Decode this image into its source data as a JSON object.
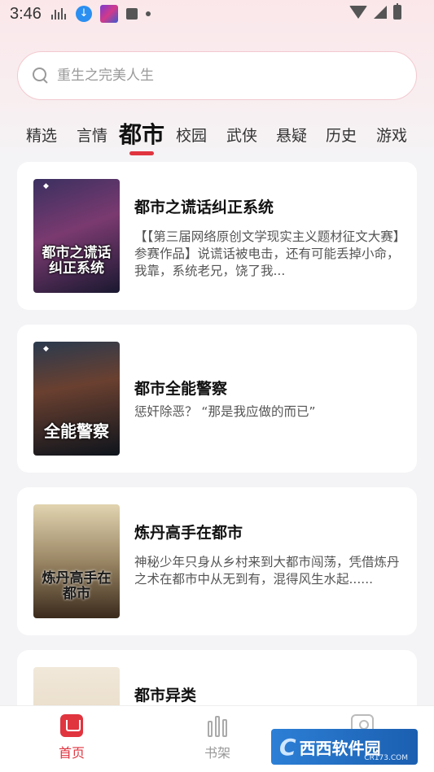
{
  "status_bar": {
    "time": "3:46"
  },
  "search": {
    "placeholder": "重生之完美人生"
  },
  "tabs": [
    {
      "label": "精选"
    },
    {
      "label": "言情"
    },
    {
      "label": "都市",
      "active": true
    },
    {
      "label": "校园"
    },
    {
      "label": "武侠"
    },
    {
      "label": "悬疑"
    },
    {
      "label": "历史"
    },
    {
      "label": "游戏"
    }
  ],
  "books": [
    {
      "title": "都市之谎话纠正系统",
      "description": "【【第三届网络原创文学现实主义题材征文大赛】参赛作品】说谎话被电击，还有可能丢掉小命，我靠，系统老兄，饶了我...",
      "cover_text": "都市之谎话纠正系统",
      "cover_colors": [
        "#2a2440",
        "#6a3a6a",
        "#1a1a2a"
      ]
    },
    {
      "title": "都市全能警察",
      "description": "惩奸除恶？ “那是我应做的而已”",
      "cover_text": "全能警察",
      "cover_colors": [
        "#1e2a3a",
        "#5a3a2a",
        "#0e1418"
      ]
    },
    {
      "title": "炼丹高手在都市",
      "description": "神秘少年只身从乡村来到大都市闯荡，凭借炼丹之术在都市中从无到有，混得风生水起......",
      "cover_text": "炼丹高手在都市",
      "cover_colors": [
        "#d8c8a0",
        "#8a7a5a",
        "#3a2a1a"
      ]
    },
    {
      "title": "都市异类",
      "description": "",
      "cover_text": "",
      "cover_colors": [
        "#efe6d8",
        "#e2d4bc",
        "#d6c6aa"
      ]
    }
  ],
  "bottom_nav": [
    {
      "label": "首页",
      "icon": "home-icon",
      "active": true
    },
    {
      "label": "书架",
      "icon": "bookshelf-icon"
    },
    {
      "label": "",
      "icon": "profile-icon"
    }
  ],
  "watermark": {
    "text": "西西软件园",
    "sub": "CR173.COM"
  },
  "colors": {
    "accent": "#e0343f",
    "background": "#f4f4f6"
  }
}
